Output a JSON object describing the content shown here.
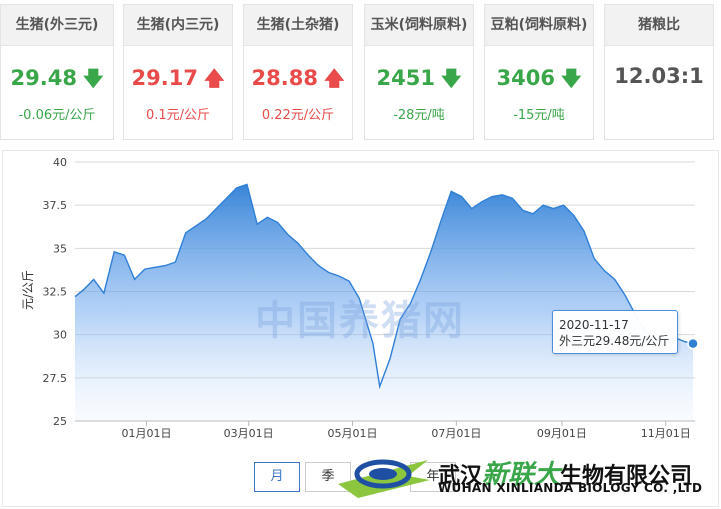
{
  "cards": [
    {
      "name": "生猪(外三元)",
      "value": "29.48",
      "dir": "down",
      "change": "-0.06元/公斤"
    },
    {
      "name": "生猪(内三元)",
      "value": "29.17",
      "dir": "up",
      "change": "0.1元/公斤"
    },
    {
      "name": "生猪(土杂猪)",
      "value": "28.88",
      "dir": "up",
      "change": "0.22元/公斤"
    },
    {
      "name": "玉米(饲料原料)",
      "value": "2451",
      "dir": "down",
      "change": "-28元/吨"
    },
    {
      "name": "豆粕(饲料原料)",
      "value": "3406",
      "dir": "down",
      "change": "-15元/吨"
    },
    {
      "name": "猪粮比",
      "value": "12.03:1",
      "dir": "none",
      "change": ""
    }
  ],
  "icons": {
    "down": "arrow-down-icon",
    "up": "arrow-up-icon"
  },
  "colors": {
    "down": "#3aa64a",
    "up": "#e94b4b",
    "line": "#2f7fd6",
    "fill_top": "#3a86dc"
  },
  "chart_data": {
    "type": "area",
    "xlabel": "",
    "ylabel": "元/公斤",
    "ylim": [
      25,
      40
    ],
    "yticks": [
      25,
      27.5,
      30,
      32.5,
      35,
      37.5,
      40
    ],
    "xtick_labels": [
      "01月01日",
      "03月01日",
      "05月01日",
      "07月01日",
      "09月01日",
      "11月01日"
    ],
    "xtick_dates": [
      "2020-01-01",
      "2020-03-01",
      "2020-05-01",
      "2020-07-01",
      "2020-09-01",
      "2020-11-01"
    ],
    "xlim": [
      "2019-11-20",
      "2020-11-17"
    ],
    "grid": true,
    "series": [
      {
        "x": [
          "2019-11-20",
          "2019-11-25",
          "2019-12-01",
          "2019-12-07",
          "2019-12-13",
          "2019-12-19",
          "2019-12-25",
          "2019-12-31",
          "2020-01-06",
          "2020-01-12",
          "2020-01-18",
          "2020-01-24",
          "2020-01-30",
          "2020-02-05",
          "2020-02-11",
          "2020-02-17",
          "2020-02-23",
          "2020-02-29",
          "2020-03-06",
          "2020-03-12",
          "2020-03-18",
          "2020-03-24",
          "2020-03-30",
          "2020-04-05",
          "2020-04-11",
          "2020-04-17",
          "2020-04-23",
          "2020-04-29",
          "2020-05-05",
          "2020-05-09",
          "2020-05-13",
          "2020-05-17",
          "2020-05-23",
          "2020-05-29",
          "2020-06-04",
          "2020-06-10",
          "2020-06-16",
          "2020-06-22",
          "2020-06-28",
          "2020-07-04",
          "2020-07-10",
          "2020-07-16",
          "2020-07-22",
          "2020-07-28",
          "2020-08-03",
          "2020-08-09",
          "2020-08-15",
          "2020-08-21",
          "2020-08-27",
          "2020-09-02",
          "2020-09-08",
          "2020-09-14",
          "2020-09-20",
          "2020-09-26",
          "2020-10-02",
          "2020-10-08",
          "2020-10-14",
          "2020-10-20",
          "2020-10-26",
          "2020-11-01",
          "2020-11-07",
          "2020-11-12",
          "2020-11-17"
        ],
        "values": [
          32.2,
          32.6,
          33.2,
          32.4,
          34.8,
          34.6,
          33.2,
          33.8,
          33.9,
          34.0,
          34.2,
          35.9,
          36.3,
          36.7,
          37.3,
          37.9,
          38.5,
          38.7,
          36.4,
          36.8,
          36.5,
          35.8,
          35.3,
          34.6,
          34.0,
          33.6,
          33.4,
          33.1,
          32.1,
          30.8,
          29.5,
          27.0,
          28.6,
          30.9,
          31.8,
          33.2,
          34.8,
          36.6,
          38.3,
          38.0,
          37.3,
          37.7,
          38.0,
          38.1,
          37.9,
          37.2,
          37.0,
          37.5,
          37.3,
          37.5,
          36.9,
          36.0,
          34.4,
          33.7,
          33.2,
          32.3,
          31.2,
          30.2,
          29.9,
          29.7,
          29.8,
          29.6,
          29.48
        ]
      }
    ]
  },
  "tooltip": {
    "date": "2020-11-17",
    "text": "外三元29.48元/公斤"
  },
  "watermark": "中国养猪网",
  "periods": [
    "月",
    "季",
    "年"
  ],
  "logo": {
    "cn_1": "武汉",
    "cn_2": "新联大",
    "cn_3": "生物有限公司",
    "en": "WUHAN XINLIANDA BIOLOGY CO. ,LTD"
  }
}
